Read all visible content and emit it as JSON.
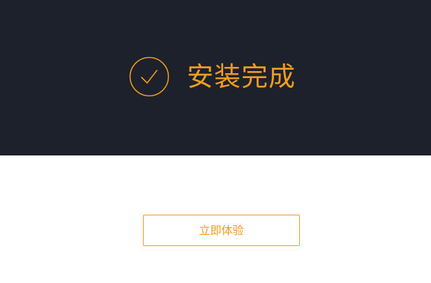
{
  "header": {
    "status_icon": "check-circle-icon",
    "status_title": "安装完成"
  },
  "content": {
    "start_button_label": "立即体验"
  },
  "colors": {
    "header_background": "#1c212b",
    "accent": "#f39c1e",
    "content_background": "#ffffff"
  }
}
